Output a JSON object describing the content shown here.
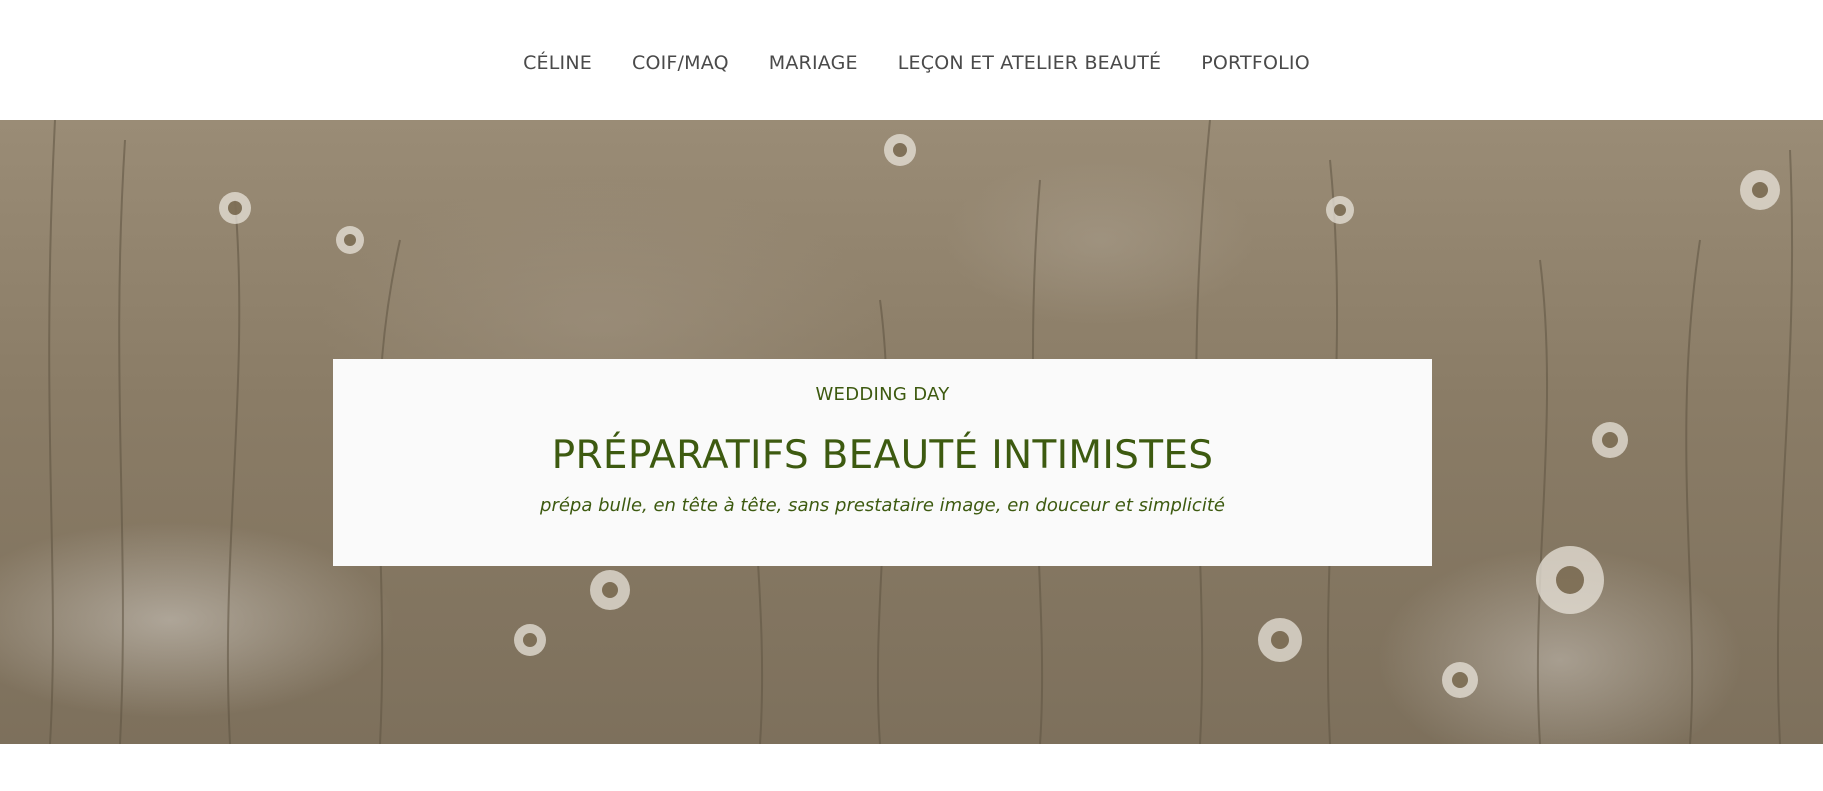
{
  "nav": {
    "items": [
      {
        "label": "CÉLINE"
      },
      {
        "label": "COIF/MAQ"
      },
      {
        "label": "MARIAGE"
      },
      {
        "label": "LEÇON ET ATELIER BEAUTÉ"
      },
      {
        "label": "PORTFOLIO"
      }
    ]
  },
  "hero": {
    "kicker": "WEDDING DAY",
    "title": "PRÉPARATIFS BEAUTÉ INTIMISTES",
    "subtitle": "prépa bulle, en tête à tête, sans prestataire image, en douceur et simplicité",
    "background_image": "daisy-field-photo"
  },
  "colors": {
    "accent_text": "#3d5a10",
    "nav_text": "#4a4a4a",
    "card_background": "#fafafa"
  }
}
